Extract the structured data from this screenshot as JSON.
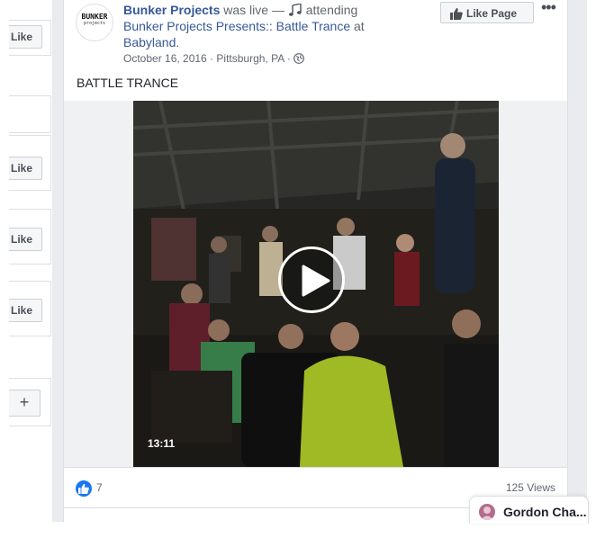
{
  "left_column": {
    "like_buttons": [
      "Like",
      "Like",
      "Like",
      "Like"
    ],
    "add_button": "+"
  },
  "post": {
    "page_name": "Bunker Projects",
    "live_text": " was live — ",
    "activity_icon": "music-note-icon",
    "activity_text": " attending ",
    "event_name": "Bunker Projects Presents:: Battle Trance",
    "at_text": " at ",
    "location_name": "Babyland",
    "period": ".",
    "date": "October 16, 2016",
    "place": "Pittsburgh, PA",
    "separator": " · ",
    "privacy_icon": "globe-icon",
    "avatar_line1": "BUNKER",
    "avatar_line2": "projects",
    "like_page_label": "Like Page",
    "more_label": "•••",
    "text": "BATTLE TRANCE",
    "video": {
      "duration": "13:11",
      "play_icon": "play-icon"
    },
    "reactions": {
      "icon": "thumbs-up-icon",
      "count": "7",
      "views": "125 Views"
    }
  },
  "chat": {
    "contact_name": "Gordon Cha..."
  },
  "colors": {
    "link": "#385898",
    "facebook_blue": "#1877f2",
    "background": "#e9ebee"
  }
}
